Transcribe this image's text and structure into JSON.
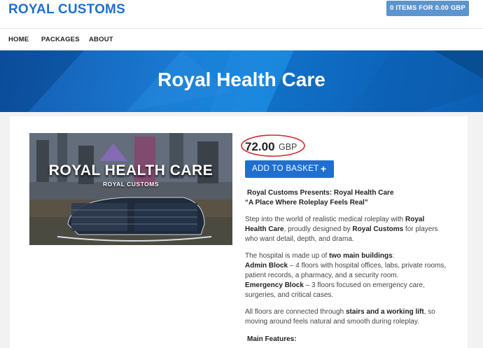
{
  "header": {
    "logo": "ROYAL CUSTOMS",
    "basket_button": "0 ITEMS FOR 0.00 GBP"
  },
  "nav": {
    "items": [
      {
        "label": "HOME"
      },
      {
        "label": "PACKAGES"
      },
      {
        "label": "ABOUT"
      }
    ]
  },
  "banner": {
    "title": "Royal Health Care"
  },
  "product": {
    "image_title": "ROYAL HEALTH CARE",
    "image_subtitle": "ROYAL CUSTOMS",
    "price": "72.00",
    "currency": "GBP",
    "add_button": "ADD TO BASKET",
    "add_icon": "+",
    "colors": {
      "accent": "#1f6fd1",
      "price_circle": "#d9252b"
    }
  },
  "description": {
    "intro_line1": "Royal Customs Presents: Royal Health Care",
    "intro_line2": "“A Place Where Roleplay Feels Real”",
    "p1_a": "Step into the world of realistic medical roleplay with ",
    "p1_b": "Royal",
    "p1_c": "Health Care",
    "p1_d": ", proudly designed by ",
    "p1_e": "Royal Customs",
    "p1_f": " for players",
    "p1_g": "who want detail, depth, and drama.",
    "p2_a": "The hospital is made up of ",
    "p2_b": "two main buildings",
    "p2_c": ":",
    "admin_label": "Admin Block",
    "admin_text1": " – 4 floors with hospital offices, labs, private rooms,",
    "admin_text2": "patient records, a pharmacy, and a security room.",
    "emergency_label": "Emergency Block",
    "emergency_text1": " – 3 floors focused on emergency care,",
    "emergency_text2": "surgeries, and critical cases.",
    "p3_a": "All floors are connected through ",
    "p3_b": "stairs and a working lift",
    "p3_c": ", so",
    "p3_d": "moving around feels natural and smooth during roleplay.",
    "features_heading": "Main Features:"
  }
}
